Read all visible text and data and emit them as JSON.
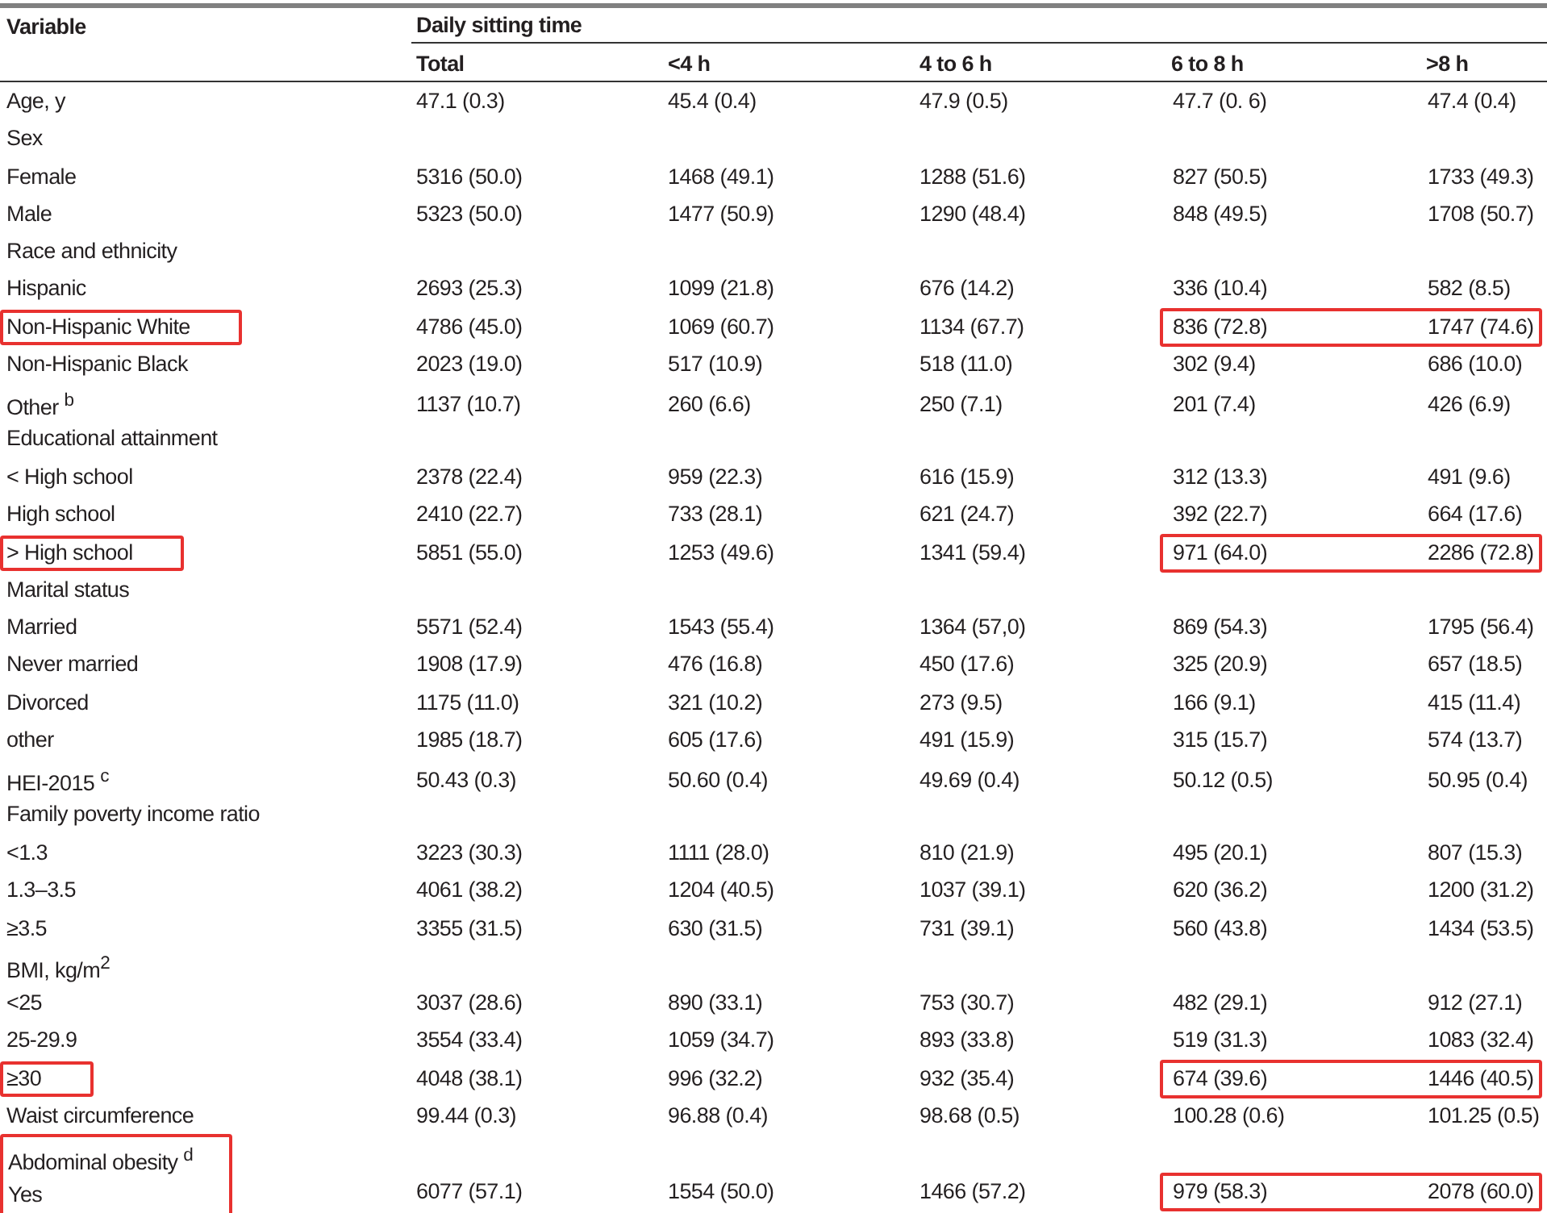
{
  "table": {
    "variable_header": "Variable",
    "group_header": "Daily sitting time",
    "columns": [
      "Total",
      "<4 h",
      "4 to 6 h",
      "6 to 8 h",
      ">8 h"
    ],
    "rows": [
      {
        "kind": "row",
        "label": "Age, y",
        "values": [
          "47.1 (0.3)",
          "45.4 (0.4)",
          "47.9 (0.5)",
          "47.7 (0. 6)",
          "47.4 (0.4)"
        ],
        "label_marked": false,
        "values_marked": false
      },
      {
        "kind": "row",
        "label": "Sex",
        "label_marked": false,
        "values_marked": false
      },
      {
        "kind": "row",
        "label": "Female",
        "values": [
          "5316 (50.0)",
          "1468 (49.1)",
          "1288 (51.6)",
          "827 (50.5)",
          "1733 (49.3)"
        ],
        "label_marked": false,
        "values_marked": false
      },
      {
        "kind": "row",
        "label": "Male",
        "values": [
          "5323 (50.0)",
          "1477 (50.9)",
          "1290 (48.4)",
          "848 (49.5)",
          "1708 (50.7)"
        ],
        "label_marked": false,
        "values_marked": false
      },
      {
        "kind": "row",
        "label": "Race and ethnicity",
        "label_marked": false,
        "values_marked": false
      },
      {
        "kind": "row",
        "label": "Hispanic",
        "values": [
          "2693 (25.3)",
          "1099 (21.8)",
          "676 (14.2)",
          "336 (10.4)",
          "582 (8.5)"
        ],
        "label_marked": false,
        "values_marked": false
      },
      {
        "kind": "row",
        "label": "Non-Hispanic White",
        "values": [
          "4786 (45.0)",
          "1069 (60.7)",
          "1134 (67.7)",
          "836 (72.8)",
          "1747 (74.6)"
        ],
        "label_marked": true,
        "values_marked": true
      },
      {
        "kind": "row",
        "label": "Non-Hispanic Black",
        "values": [
          "2023 (19.0)",
          "517 (10.9)",
          "518 (11.0)",
          "302 (9.4)",
          "686 (10.0)"
        ],
        "label_marked": false,
        "values_marked": false
      },
      {
        "kind": "row",
        "label": "Other $^{b}$",
        "values": [
          "1137 (10.7)",
          "260 (6.6)",
          "250 (7.1)",
          "201 (7.4)",
          "426 (6.9)"
        ],
        "label_marked": false,
        "values_marked": false
      },
      {
        "kind": "row",
        "label": "Educational attainment",
        "label_marked": false,
        "values_marked": false
      },
      {
        "kind": "row",
        "label": "< High school",
        "values": [
          "2378 (22.4)",
          "959 (22.3)",
          "616 (15.9)",
          "312 (13.3)",
          "491 (9.6)"
        ],
        "label_marked": false,
        "values_marked": false
      },
      {
        "kind": "row",
        "label": "High school",
        "values": [
          "2410 (22.7)",
          "733 (28.1)",
          "621 (24.7)",
          "392 (22.7)",
          "664 (17.6)"
        ],
        "label_marked": false,
        "values_marked": false
      },
      {
        "kind": "row",
        "label": "> High school",
        "values": [
          "5851 (55.0)",
          "1253 (49.6)",
          "1341 (59.4)",
          "971 (64.0)",
          "2286 (72.8)"
        ],
        "label_marked": true,
        "values_marked": true
      },
      {
        "kind": "row",
        "label": "Marital status",
        "label_marked": false,
        "values_marked": false
      },
      {
        "kind": "row",
        "label": "Married",
        "values": [
          "5571 (52.4)",
          "1543 (55.4)",
          "1364 (57,0)",
          "869 (54.3)",
          "1795 (56.4)"
        ],
        "label_marked": false,
        "values_marked": false
      },
      {
        "kind": "row",
        "label": "Never married",
        "values": [
          "1908 (17.9)",
          "476 (16.8)",
          "450 (17.6)",
          "325 (20.9)",
          "657 (18.5)"
        ],
        "label_marked": false,
        "values_marked": false
      },
      {
        "kind": "row",
        "label": "Divorced",
        "values": [
          "1175 (11.0)",
          "321 (10.2)",
          "273 (9.5)",
          "166 (9.1)",
          "415 (11.4)"
        ],
        "label_marked": false,
        "values_marked": false
      },
      {
        "kind": "row",
        "label": "other",
        "values": [
          "1985 (18.7)",
          "605 (17.6)",
          "491 (15.9)",
          "315 (15.7)",
          "574 (13.7)"
        ],
        "label_marked": false,
        "values_marked": false
      },
      {
        "kind": "row",
        "label": "HEI-2015 $^{c}$",
        "values": [
          "50.43 (0.3)",
          "50.60 (0.4)",
          "49.69 (0.4)",
          "50.12 (0.5)",
          "50.95 (0.4)"
        ],
        "label_marked": false,
        "values_marked": false
      },
      {
        "kind": "row",
        "label": "Family poverty income ratio",
        "label_marked": false,
        "values_marked": false
      },
      {
        "kind": "row",
        "label": "<1.3",
        "values": [
          "3223 (30.3)",
          "1111 (28.0)",
          "810 (21.9)",
          "495 (20.1)",
          "807 (15.3)"
        ],
        "label_marked": false,
        "values_marked": false
      },
      {
        "kind": "row",
        "label": "1.3–3.5",
        "values": [
          "4061 (38.2)",
          "1204 (40.5)",
          "1037 (39.1)",
          "620 (36.2)",
          "1200 (31.2)"
        ],
        "label_marked": false,
        "values_marked": false
      },
      {
        "kind": "row",
        "label": "≥3.5",
        "values": [
          "3355 (31.5)",
          "630 (31.5)",
          "731 (39.1)",
          "560 (43.8)",
          "1434 (53.5)"
        ],
        "label_marked": false,
        "values_marked": false
      },
      {
        "kind": "row",
        "label": "BMI, kg/m$^{2}$",
        "label_marked": false,
        "values_marked": false
      },
      {
        "kind": "row",
        "label": "<25",
        "values": [
          "3037 (28.6)",
          "890 (33.1)",
          "753 (30.7)",
          "482 (29.1)",
          "912 (27.1)"
        ],
        "label_marked": false,
        "values_marked": false
      },
      {
        "kind": "row",
        "label": "25-29.9",
        "values": [
          "3554 (33.4)",
          "1059 (34.7)",
          "893 (33.8)",
          "519 (31.3)",
          "1083 (32.4)"
        ],
        "label_marked": false,
        "values_marked": false
      },
      {
        "kind": "row",
        "label": "≥30",
        "values": [
          "4048 (38.1)",
          "996 (32.2)",
          "932 (35.4)",
          "674 (39.6)",
          "1446 (40.5)"
        ],
        "label_marked": true,
        "values_marked": true
      },
      {
        "kind": "row",
        "label": "Waist circumference",
        "values": [
          "99.44 (0.3)",
          "96.88 (0.4)",
          "98.68 (0.5)",
          "100.28 (0.6)",
          "101.25 (0.5)"
        ],
        "label_marked": false,
        "values_marked": false
      },
      {
        "kind": "block",
        "labels_marked": true,
        "rows": [
          {
            "label": "Abdominal obesity $^{d}$",
            "values_marked": false
          },
          {
            "label": "Yes",
            "values": [
              "6077 (57.1)",
              "1554 (50.0)",
              "1466 (57.2)",
              "979 (58.3)",
              "2078 (60.0)"
            ],
            "values_marked": true
          }
        ]
      }
    ]
  }
}
